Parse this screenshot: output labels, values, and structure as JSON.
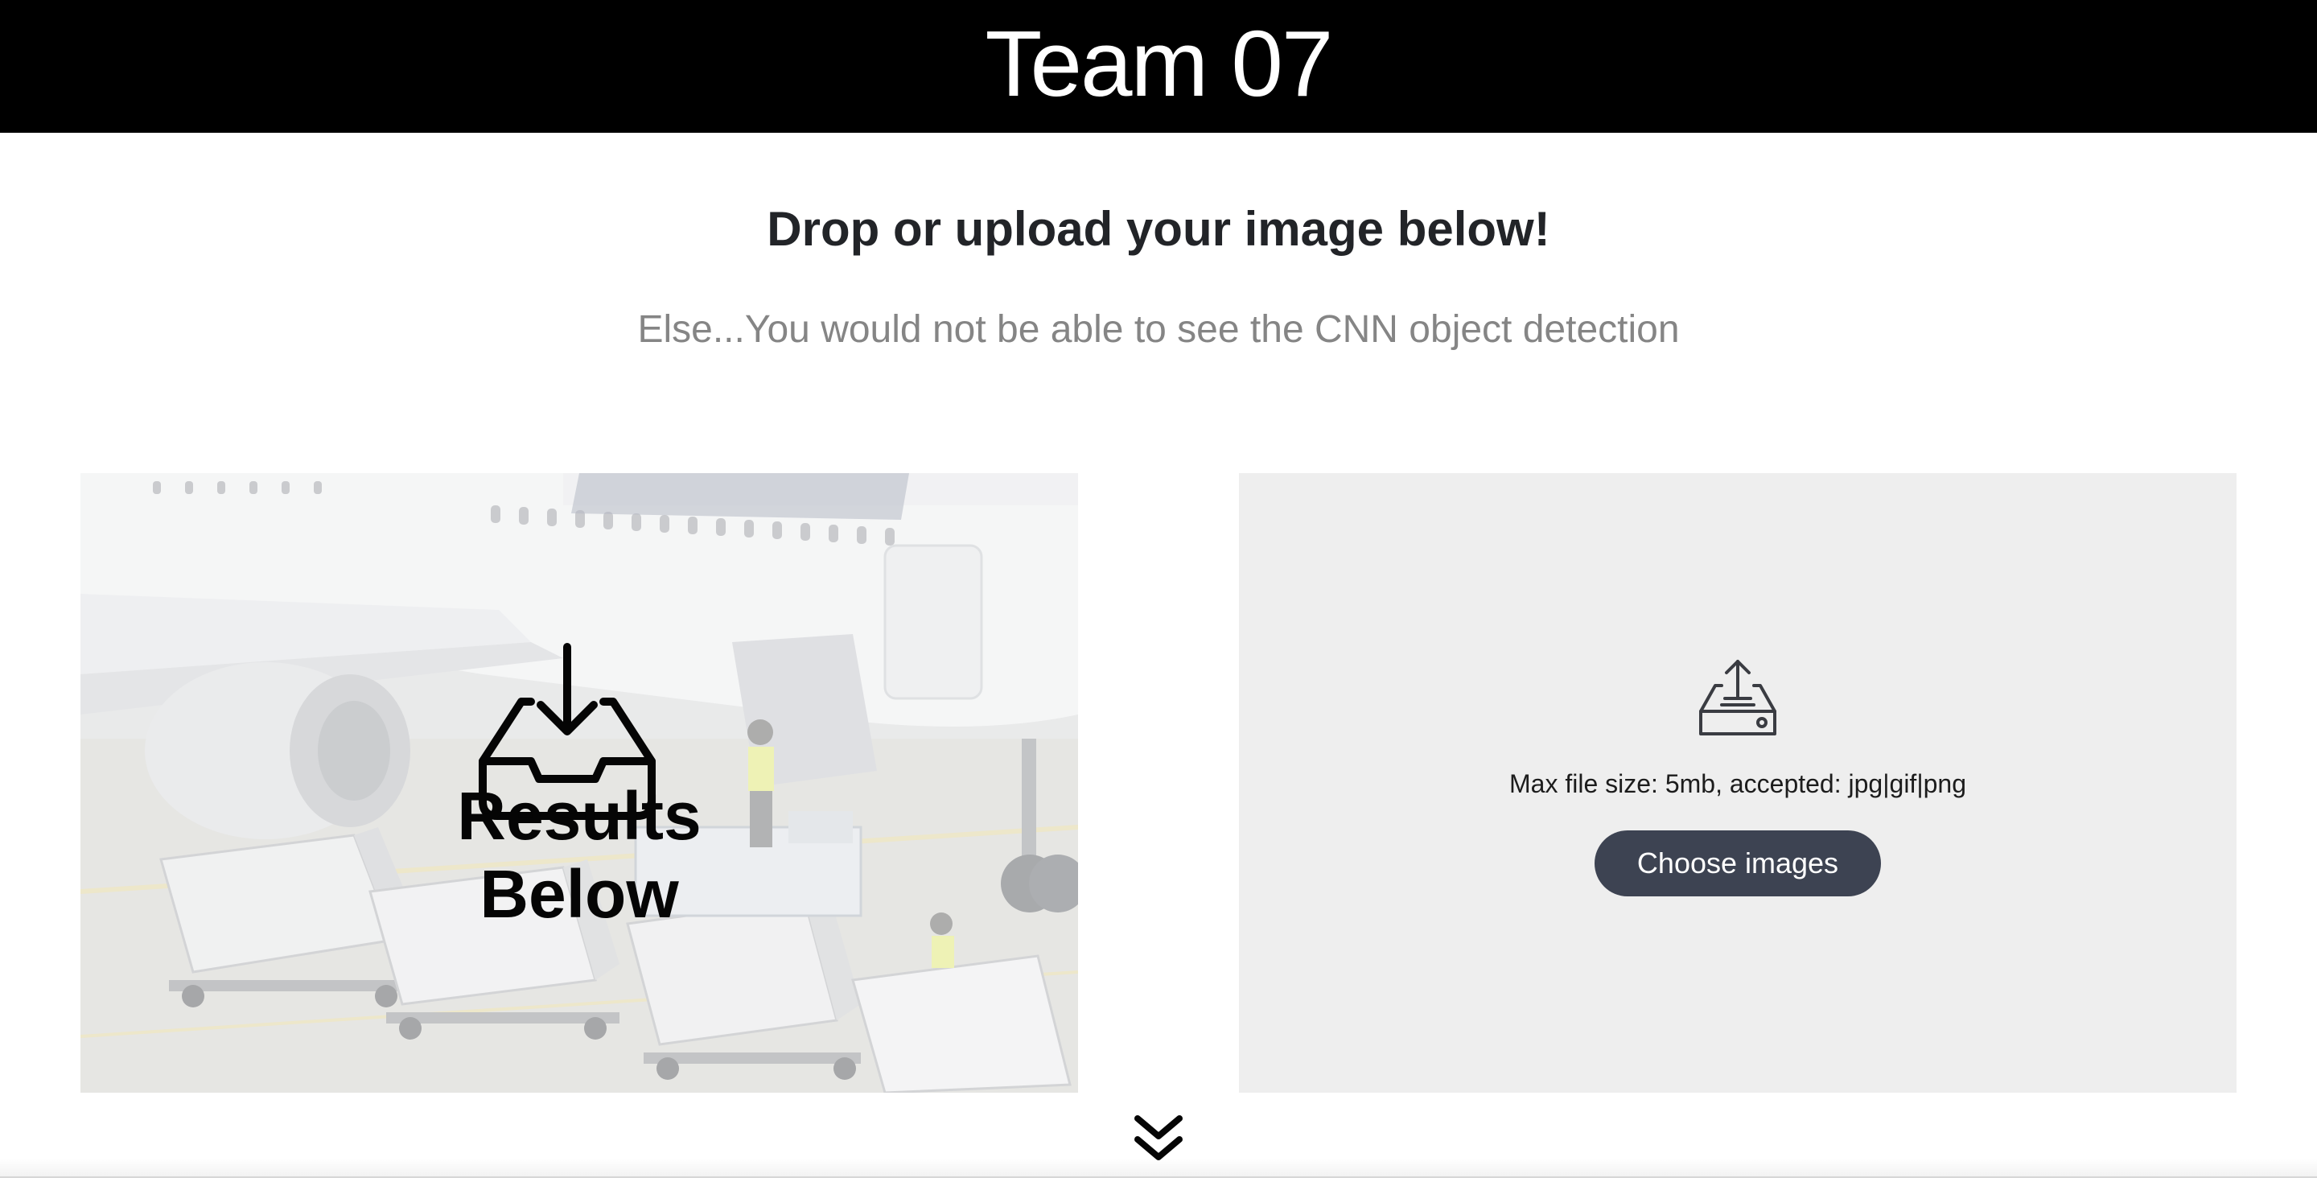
{
  "header": {
    "title": "Team 07"
  },
  "intro": {
    "heading": "Drop or upload your image below!",
    "subheading": "Else...You would not be able to see the CNN object detection"
  },
  "results": {
    "label": "Results Below",
    "icon": "inbox-download-icon"
  },
  "upload": {
    "icon": "upload-drive-icon",
    "note": "Max file size: 5mb, accepted: jpg|gif|png",
    "button_label": "Choose images",
    "button_color": "#3d4352"
  },
  "scroll": {
    "icon": "double-chevron-down-icon"
  }
}
